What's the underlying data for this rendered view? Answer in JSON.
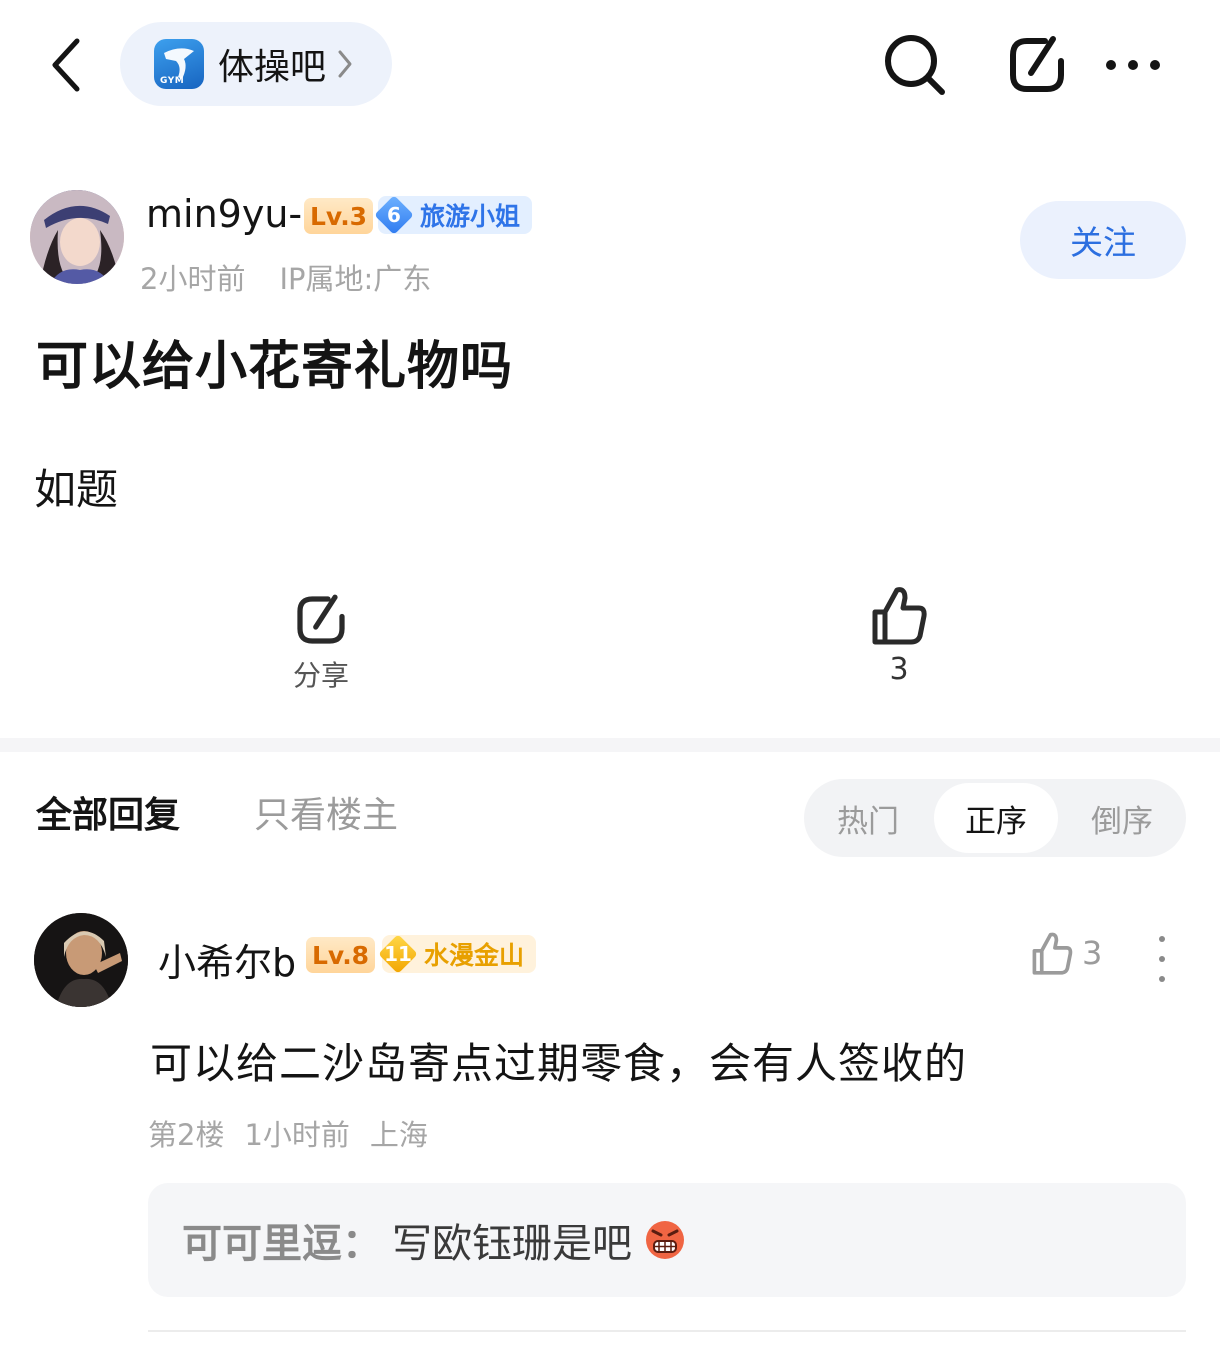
{
  "header": {
    "forum_name": "体操吧",
    "forum_logo_text": "GYM"
  },
  "post": {
    "author": {
      "name": "min9yu-",
      "level": "Lv.3",
      "honor_level": "6",
      "honor_title": "旅游小姐"
    },
    "time": "2小时前",
    "ip_location": "IP属地:广东",
    "follow_label": "关注",
    "title": "可以给小花寄礼物吗",
    "body": "如题",
    "share_label": "分享",
    "like_count": "3"
  },
  "replies_tabs": {
    "all_label": "全部回复",
    "op_only_label": "只看楼主",
    "sort_options": [
      "热门",
      "正序",
      "倒序"
    ],
    "selected_sort": "正序"
  },
  "reply": {
    "author": {
      "name": "小希尔b",
      "level": "Lv.8",
      "honor_level": "11",
      "honor_title": "水漫金山"
    },
    "like_count": "3",
    "content": "可以给二沙岛寄点过期零食，会有人签收的",
    "floor": "第2楼",
    "time": "1小时前",
    "location": "上海",
    "sub_reply": {
      "author": "可可里逗：",
      "text": "写欧钰珊是吧",
      "emoji": "angry-face-emoji"
    }
  },
  "colors": {
    "accent_blue": "#2c6fe0",
    "level_orange": "#d86a00",
    "honor_blue": "#2f74e8",
    "honor_gold": "#e8a000"
  }
}
